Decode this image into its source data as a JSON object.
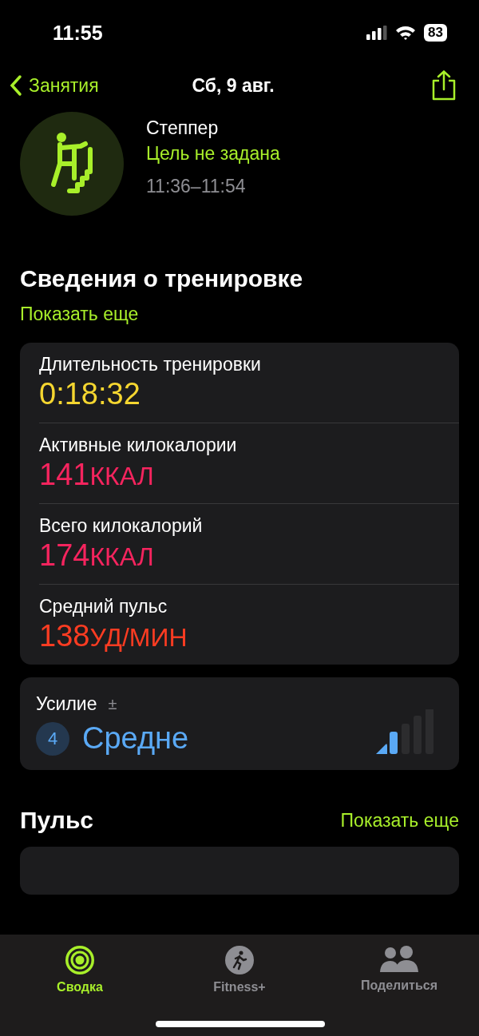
{
  "status_bar": {
    "time": "11:55",
    "battery": "83"
  },
  "nav": {
    "back": "Занятия",
    "title": "Сб, 9 авг."
  },
  "workout": {
    "name": "Степпер",
    "goal": "Цель не задана",
    "time_range": "11:36–11:54"
  },
  "details": {
    "title": "Сведения о тренировке",
    "show_more": "Показать еще",
    "metrics": [
      {
        "label": "Длительность тренировки",
        "value": "0:18:32",
        "color": "#f5d630"
      },
      {
        "label": "Активные килокалории",
        "value": "141",
        "unit": "ККАЛ",
        "color": "#f5245e"
      },
      {
        "label": "Всего килокалорий",
        "value": "174",
        "unit": "ККАЛ",
        "color": "#f5245e"
      },
      {
        "label": "Средний пульс",
        "value": "138",
        "unit": "УД/МИН",
        "color": "#fb3c22"
      }
    ]
  },
  "effort": {
    "label": "Усилие",
    "adjust": "±",
    "score": "4",
    "rating": "Средне",
    "level": 0.4
  },
  "heart_rate": {
    "title": "Пульс",
    "show_more": "Показать еще"
  },
  "tabs": [
    {
      "label": "Сводка",
      "selected": true,
      "kind": "rings"
    },
    {
      "label": "Fitness+",
      "selected": false,
      "kind": "runner"
    },
    {
      "label": "Поделиться",
      "selected": false,
      "kind": "people"
    }
  ]
}
